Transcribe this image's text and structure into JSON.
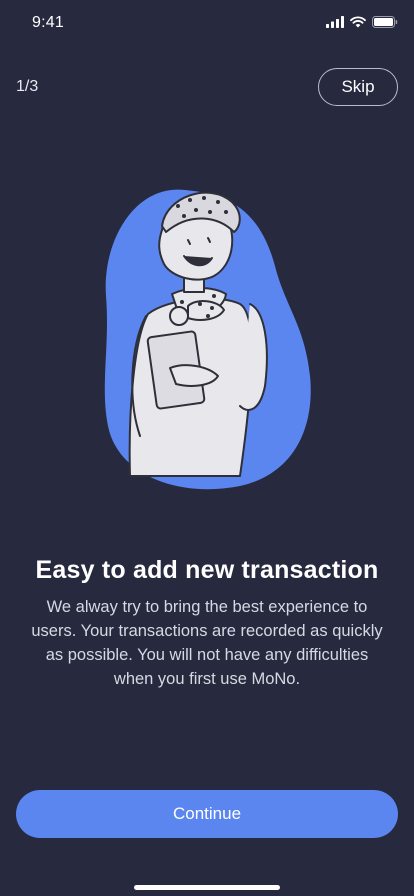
{
  "status_bar": {
    "time": "9:41",
    "icons": [
      "signal-icon",
      "wifi-icon",
      "battery-icon"
    ]
  },
  "header": {
    "pager": "1/3",
    "skip_label": "Skip"
  },
  "illustration": {
    "icon": "person-holding-notebook-illustration",
    "blob_color": "#5b86f0"
  },
  "content": {
    "title": "Easy to add new transaction",
    "description": "We alway try to bring the best experience to users. Your transactions are recorded as quickly as possible. You will not have any difficulties when you first use MoNo."
  },
  "footer": {
    "continue_label": "Continue"
  },
  "colors": {
    "background": "#272a3f",
    "accent": "#5b86f0",
    "text": "#ffffff"
  }
}
